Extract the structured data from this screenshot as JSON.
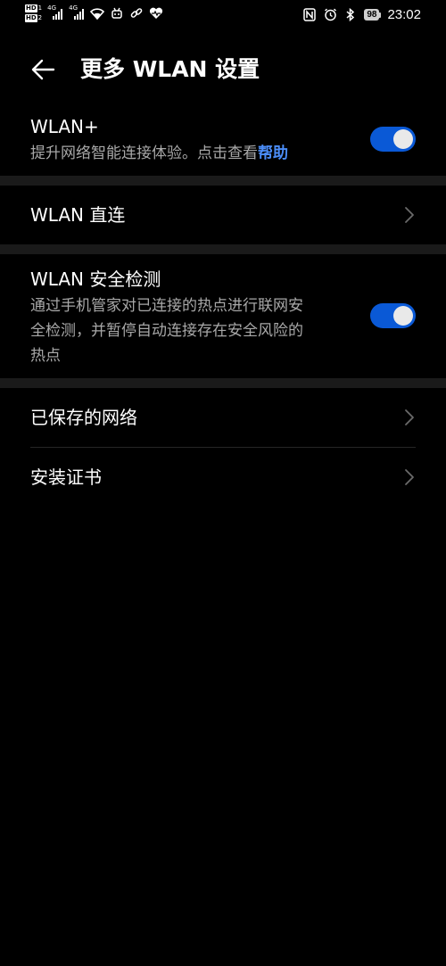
{
  "status_bar": {
    "left_badges": [
      {
        "label": "HD",
        "num": "1"
      },
      {
        "label": "HD",
        "num": "2"
      }
    ],
    "signal_1_gen": "4G",
    "signal_2_gen": "4G",
    "battery": "98",
    "time": "23:02"
  },
  "header": {
    "title": "更多 WLAN 设置"
  },
  "items": {
    "wlan_plus": {
      "title": "WLAN+",
      "subtitle_prefix": "提升网络智能连接体验。点击查看",
      "help_link": "帮助",
      "toggle_on": true
    },
    "wlan_direct": {
      "title": "WLAN 直连"
    },
    "security_check": {
      "title": "WLAN 安全检测",
      "subtitle_line1": "通过手机管家对已连接的热点进行联网安",
      "subtitle_line2": "全检测，并暂停自动连接存在安全风险的",
      "subtitle_line3": "热点",
      "toggle_on": true
    },
    "saved_networks": {
      "title": "已保存的网络"
    },
    "install_cert": {
      "title": "安装证书"
    }
  },
  "colors": {
    "background": "#000000",
    "band": "#1a1a1a",
    "accent": "#0a59d6",
    "link": "#4b8df8",
    "subtitle": "#a8a8a8"
  }
}
